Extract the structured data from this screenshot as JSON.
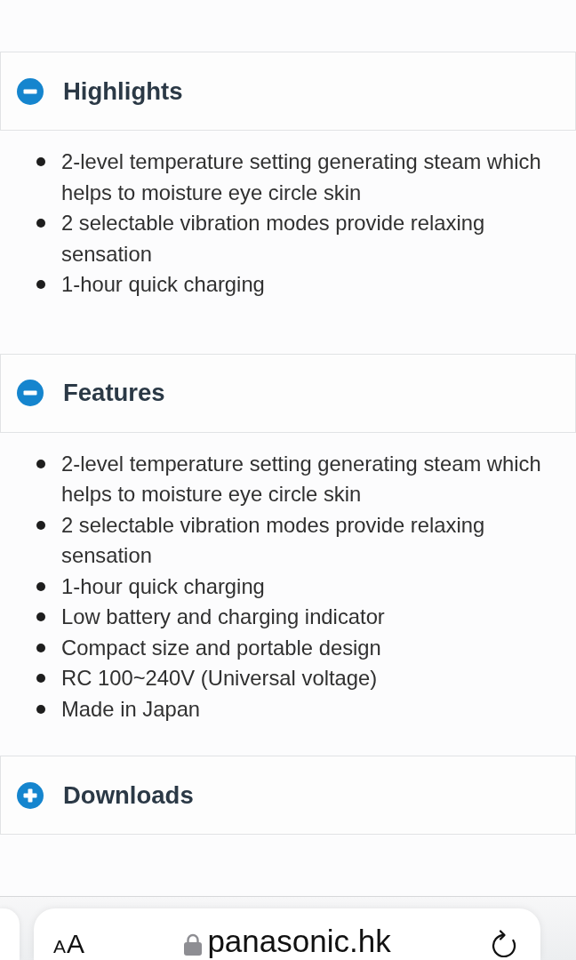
{
  "sections": [
    {
      "title": "Highlights",
      "expanded": true,
      "items": [
        "2-level temperature setting generating steam which helps to moisture eye circle skin",
        "2 selectable vibration modes provide relaxing sensation",
        "1-hour quick charging"
      ]
    },
    {
      "title": "Features",
      "expanded": true,
      "items": [
        "2-level temperature setting generating steam which helps to moisture eye circle skin",
        "2 selectable vibration modes provide relaxing sensation",
        "1-hour quick charging",
        "Low battery and charging indicator",
        "Compact size and portable design",
        "RC 100~240V (Universal voltage)",
        "Made in Japan"
      ]
    },
    {
      "title": "Downloads",
      "expanded": false
    }
  ],
  "browser_toolbar": {
    "text_size_button": "AA",
    "url": "panasonic.hk"
  }
}
